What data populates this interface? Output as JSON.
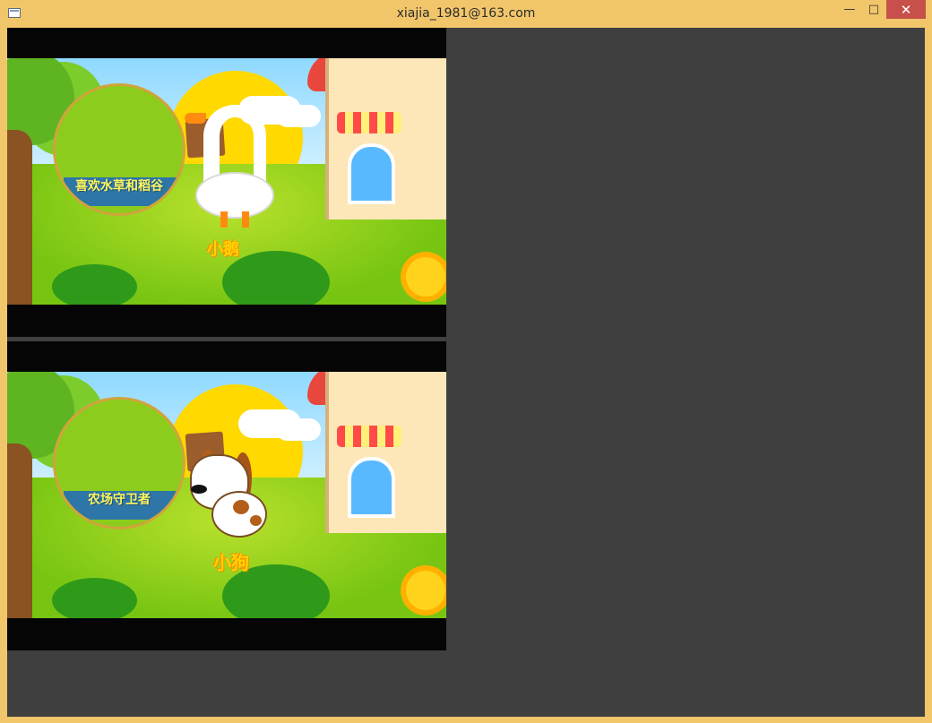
{
  "window": {
    "title": "xiajia_1981@163.com",
    "controls": {
      "minimize": "—",
      "maximize": "□",
      "close": "✕"
    }
  },
  "frames": [
    {
      "callout": "喜欢水草和稻谷",
      "animal": "小鹅"
    },
    {
      "callout": "农场守卫者",
      "animal": "小狗"
    }
  ],
  "colors": {
    "titlebar": "#f1c66a",
    "close": "#c7504a",
    "client": "#3f3f3f",
    "video_background": "#050505",
    "sun": "#ffd900",
    "grass": "#7cc716",
    "label": "#ffd400"
  },
  "icons": [
    "app-window-icon",
    "minimize-icon",
    "maximize-icon",
    "close-icon"
  ]
}
